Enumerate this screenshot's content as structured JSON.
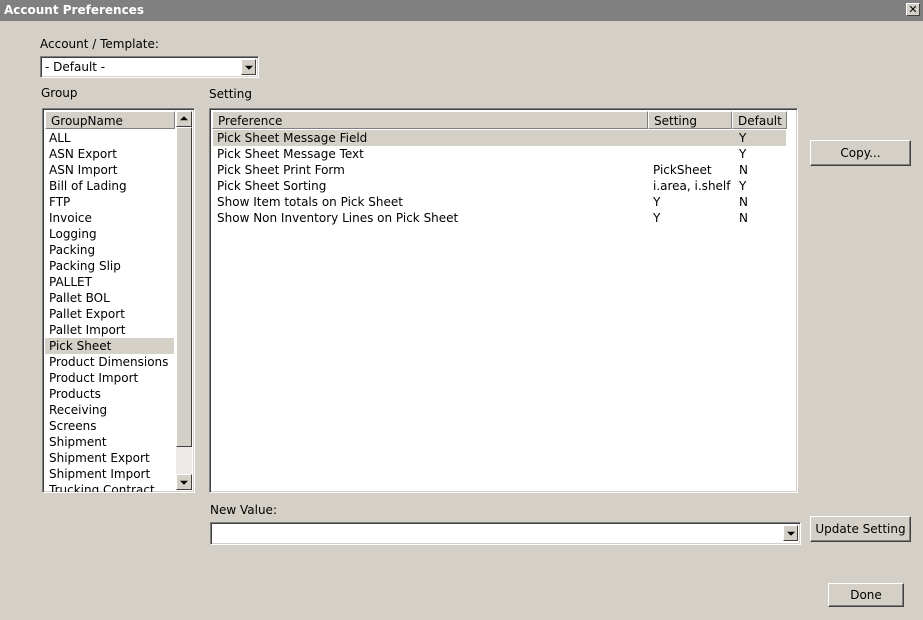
{
  "window": {
    "title": "Account Preferences",
    "close_glyph": "✕"
  },
  "account": {
    "label": "Account / Template:",
    "value": "- Default -"
  },
  "group": {
    "label": "Group",
    "column": "GroupName",
    "selected": "Pick Sheet",
    "items": [
      "ALL",
      "ASN Export",
      "ASN Import",
      "Bill of Lading",
      "FTP",
      "Invoice",
      "Logging",
      "Packing",
      "Packing Slip",
      "PALLET",
      "Pallet BOL",
      "Pallet Export",
      "Pallet Import",
      "Pick Sheet",
      "Product Dimensions",
      "Product Import",
      "Products",
      "Receiving",
      "Screens",
      "Shipment",
      "Shipment Export",
      "Shipment Import",
      "Trucking Contract"
    ]
  },
  "setting": {
    "label": "Setting",
    "columns": {
      "preference": "Preference",
      "setting": "Setting",
      "default": "Default"
    },
    "rows": [
      {
        "preference": "Pick Sheet Message Field",
        "setting": "",
        "default": "Y",
        "selected": true
      },
      {
        "preference": "Pick Sheet Message Text",
        "setting": "",
        "default": "Y"
      },
      {
        "preference": "Pick Sheet Print Form",
        "setting": "PickSheet",
        "default": "N"
      },
      {
        "preference": "Pick Sheet Sorting",
        "setting": "i.area, i.shelf",
        "default": "Y"
      },
      {
        "preference": "Show Item totals on Pick Sheet",
        "setting": "Y",
        "default": "N"
      },
      {
        "preference": "Show Non Inventory Lines on Pick Sheet",
        "setting": "Y",
        "default": "N"
      }
    ]
  },
  "new_value": {
    "label": "New Value:",
    "value": ""
  },
  "buttons": {
    "copy": "Copy...",
    "update": "Update Setting",
    "done": "Done"
  },
  "colors": {
    "titlebar": "#808080",
    "face": "#d4d0c8",
    "selection": "#d4d0c8"
  }
}
